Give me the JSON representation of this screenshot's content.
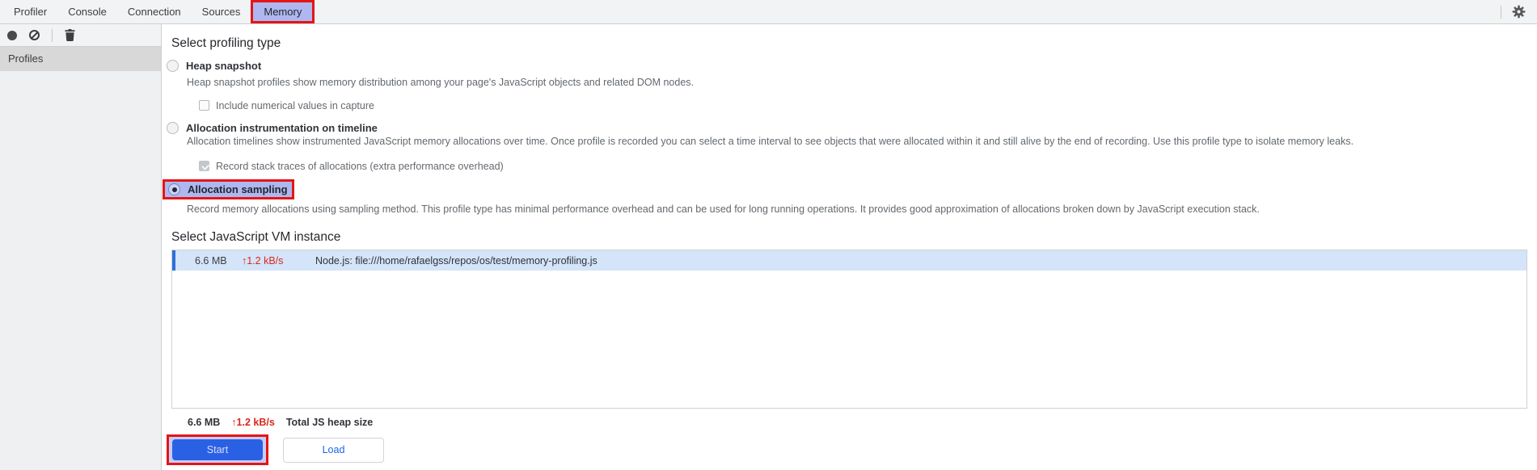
{
  "tabs": {
    "items": [
      {
        "label": "Profiler"
      },
      {
        "label": "Console"
      },
      {
        "label": "Connection"
      },
      {
        "label": "Sources"
      },
      {
        "label": "Memory"
      }
    ],
    "selected": "Memory"
  },
  "toolbar": {
    "record_icon": "record-icon",
    "clear_icon": "clear-icon",
    "delete_icon": "trash-icon",
    "settings_icon": "gear-icon"
  },
  "sidebar": {
    "profiles_label": "Profiles"
  },
  "profiling": {
    "heading": "Select profiling type",
    "options": [
      {
        "label": "Heap snapshot",
        "selected": false,
        "description": "Heap snapshot profiles show memory distribution among your page's JavaScript objects and related DOM nodes.",
        "checkbox": {
          "label": "Include numerical values in capture",
          "checked": false
        }
      },
      {
        "label": "Allocation instrumentation on timeline",
        "selected": false,
        "description": "Allocation timelines show instrumented JavaScript memory allocations over time. Once profile is recorded you can select a time interval to see objects that were allocated within it and still alive by the end of recording. Use this profile type to isolate memory leaks.",
        "checkbox": {
          "label": "Record stack traces of allocations (extra performance overhead)",
          "checked": true
        }
      },
      {
        "label": "Allocation sampling",
        "selected": true,
        "description": "Record memory allocations using sampling method. This profile type has minimal performance overhead and can be used for long running operations. It provides good approximation of allocations broken down by JavaScript execution stack."
      }
    ]
  },
  "vm": {
    "heading": "Select JavaScript VM instance",
    "instances": [
      {
        "size": "6.6 MB",
        "arrow": "↑",
        "rate": "1.2 kB/s",
        "name": "Node.js: file:///home/rafaelgss/repos/os/test/memory-profiling.js",
        "selected": true
      }
    ],
    "total": {
      "size": "6.6 MB",
      "arrow": "↑",
      "rate": "1.2 kB/s",
      "label": "Total JS heap size"
    }
  },
  "actions": {
    "start_label": "Start",
    "load_label": "Load"
  },
  "colors": {
    "annotation_red": "#e51515",
    "highlight_lavender": "#aeb7ef",
    "highlight_lavender_light": "#c7ccf5",
    "start_blue": "#2a61e4",
    "link_blue": "#1a66e8",
    "rate_red": "#d9281c",
    "row_blue_bg": "#d4e4f9",
    "row_stripe_blue": "#2f6fdb"
  }
}
